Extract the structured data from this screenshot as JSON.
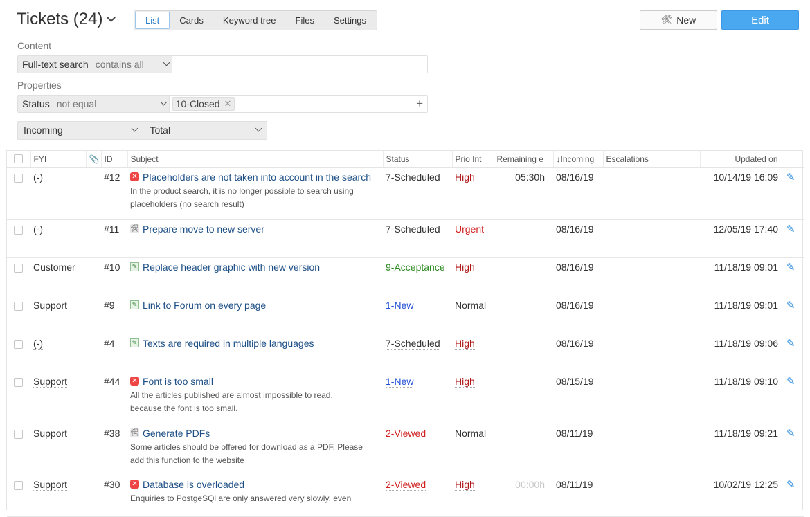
{
  "header": {
    "title": "Tickets (24)",
    "tabs": [
      "List",
      "Cards",
      "Keyword tree",
      "Files",
      "Settings"
    ],
    "new_label": "New",
    "edit_label": "Edit"
  },
  "filters": {
    "content_label": "Content",
    "fulltext_field": "Full-text search",
    "fulltext_op": "contains all",
    "properties_label": "Properties",
    "status_field": "Status",
    "status_op": "not equal",
    "status_tag": "10-Closed",
    "group_by": "Incoming",
    "aggregate": "Total"
  },
  "table": {
    "columns": [
      "FYI",
      "ID",
      "Subject",
      "Status",
      "Prio Int",
      "Remaining e",
      "Incoming",
      "Escalations",
      "Updated on"
    ],
    "rows": [
      {
        "fyi": "(-)",
        "id": "#12",
        "icon": "bug",
        "subject": "Placeholders are not taken into account in the search",
        "desc": "In the product search, it is no longer possible to search using placeholders (no search result)",
        "status": "7-Scheduled",
        "status_color": "gray",
        "prio": "High",
        "prio_color": "red",
        "remaining": "05:30h",
        "remaining_faded": false,
        "incoming": "08/16/19",
        "updated": "10/14/19 16:09"
      },
      {
        "fyi": "(-)",
        "id": "#11",
        "icon": "task",
        "subject": "Prepare move to new server",
        "desc": "",
        "status": "7-Scheduled",
        "status_color": "gray",
        "prio": "Urgent",
        "prio_color": "urgent",
        "remaining": "",
        "remaining_faded": false,
        "incoming": "08/16/19",
        "updated": "12/05/19 17:40"
      },
      {
        "fyi": "Customer",
        "id": "#10",
        "icon": "change",
        "subject": "Replace header graphic with new version",
        "desc": "",
        "status": "9-Acceptance",
        "status_color": "green",
        "prio": "High",
        "prio_color": "red",
        "remaining": "",
        "remaining_faded": false,
        "incoming": "08/16/19",
        "updated": "11/18/19 09:01"
      },
      {
        "fyi": "Support",
        "id": "#9",
        "icon": "change",
        "subject": "Link to Forum on every page",
        "desc": "",
        "status": "1-New",
        "status_color": "blue",
        "prio": "Normal",
        "prio_color": "normal",
        "remaining": "",
        "remaining_faded": false,
        "incoming": "08/16/19",
        "updated": "11/18/19 09:01"
      },
      {
        "fyi": "(-)",
        "id": "#4",
        "icon": "change",
        "subject": "Texts are required in multiple languages",
        "desc": "",
        "status": "7-Scheduled",
        "status_color": "gray",
        "prio": "High",
        "prio_color": "red",
        "remaining": "",
        "remaining_faded": false,
        "incoming": "08/16/19",
        "updated": "11/18/19 09:06"
      },
      {
        "fyi": "Support",
        "id": "#44",
        "icon": "bug",
        "subject": "Font is too small",
        "desc": "All the articles published are almost impossible to read, because the font is too small.",
        "status": "1-New",
        "status_color": "blue",
        "prio": "High",
        "prio_color": "red",
        "remaining": "",
        "remaining_faded": false,
        "incoming": "08/15/19",
        "updated": "11/18/19 09:10"
      },
      {
        "fyi": "Support",
        "id": "#38",
        "icon": "task",
        "subject": "Generate PDFs",
        "desc": "Some articles should be offered for download as a PDF. Please add this function to the website",
        "status": "2-Viewed",
        "status_color": "red",
        "prio": "Normal",
        "prio_color": "normal",
        "remaining": "",
        "remaining_faded": false,
        "incoming": "08/11/19",
        "updated": "11/18/19 09:21"
      },
      {
        "fyi": "Support",
        "id": "#30",
        "icon": "bug",
        "subject": "Database is overloaded",
        "desc": "Enquiries to PostgeSQl are only answered very slowly, even",
        "status": "2-Viewed",
        "status_color": "red",
        "prio": "High",
        "prio_color": "red",
        "remaining": "00:00h",
        "remaining_faded": true,
        "incoming": "08/11/19",
        "updated": "10/02/19 12:25"
      }
    ]
  }
}
